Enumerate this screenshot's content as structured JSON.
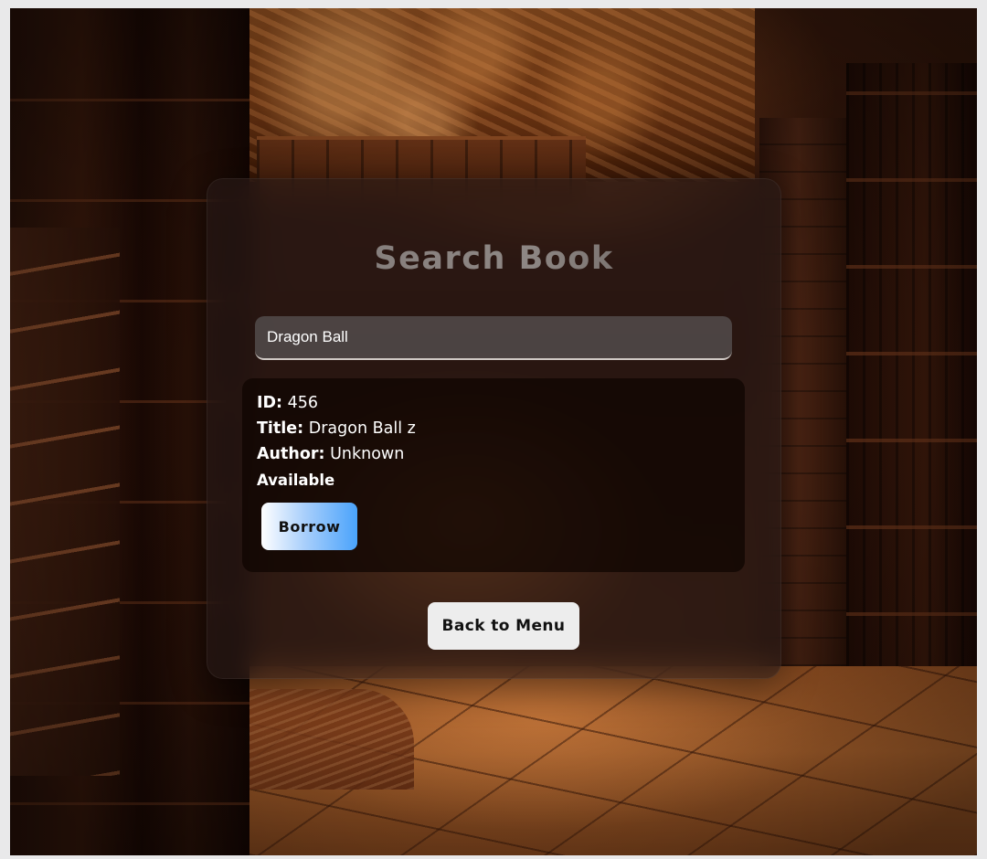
{
  "page": {
    "title": "Search Book"
  },
  "search": {
    "value": "Dragon Ball"
  },
  "result": {
    "id_label": "ID:",
    "id_value": "456",
    "title_label": "Title:",
    "title_value": "Dragon Ball z",
    "author_label": "Author:",
    "author_value": "Unknown",
    "status": "Available",
    "borrow_label": "Borrow"
  },
  "actions": {
    "back_label": "Back to Menu"
  },
  "colors": {
    "borrow_gradient_end": "#4aa3fb",
    "back_button_bg": "#ededed",
    "card_bg": "rgba(40, 28, 26, 0.55)"
  }
}
